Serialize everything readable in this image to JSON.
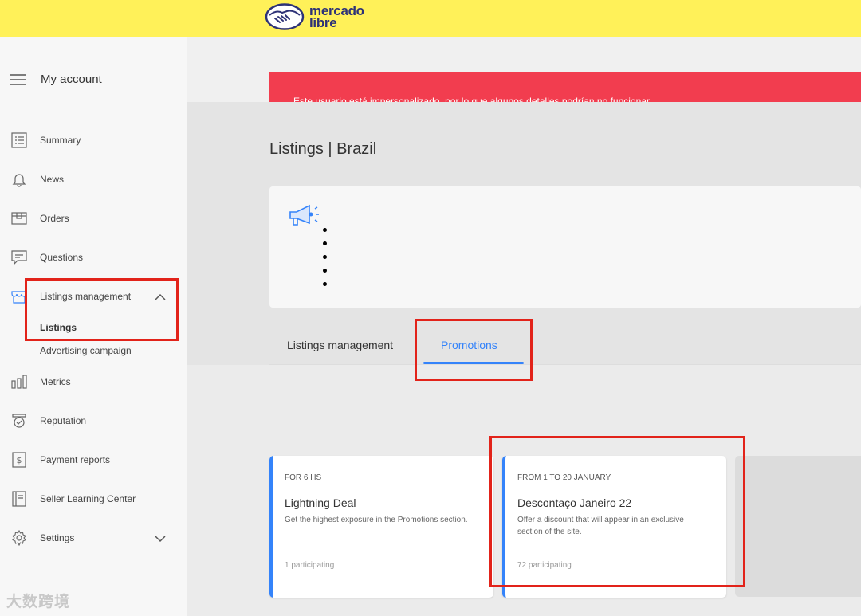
{
  "header": {
    "logo_line1": "mercado",
    "logo_line2": "libre",
    "logo_icon": "handshake-icon",
    "bg_color": "#fff159"
  },
  "sidebar": {
    "menu_label": "My account",
    "items": [
      {
        "label": "Summary",
        "icon": "summary-list-icon"
      },
      {
        "label": "News",
        "icon": "bell-icon"
      },
      {
        "label": "Orders",
        "icon": "box-icon"
      },
      {
        "label": "Questions",
        "icon": "chat-icon"
      },
      {
        "label": "Listings management",
        "icon": "store-icon",
        "expanded": true
      },
      {
        "label": "Metrics",
        "icon": "bar-chart-icon"
      },
      {
        "label": "Reputation",
        "icon": "badge-icon"
      },
      {
        "label": "Payment reports",
        "icon": "dollar-receipt-icon"
      },
      {
        "label": "Seller Learning Center",
        "icon": "book-icon"
      },
      {
        "label": "Settings",
        "icon": "gear-icon",
        "expanded": false
      }
    ],
    "sub_items": [
      {
        "label": "Listings",
        "active": true
      },
      {
        "label": "Advertising campaign",
        "active": false
      }
    ]
  },
  "alert": {
    "text": "Este usuario está impersonalizado, por lo que algunos detalles podrían no funcionar.",
    "color": "#f23d4f"
  },
  "page": {
    "title": "Listings | Brazil"
  },
  "notice": {
    "icon": "megaphone-icon"
  },
  "tabs": [
    {
      "label": "Listings management",
      "active": false
    },
    {
      "label": "Promotions",
      "active": true
    }
  ],
  "promotions": [
    {
      "tag": "FOR 6 HS",
      "title": "Lightning Deal",
      "description": "Get the highest exposure in the Promotions section.",
      "participating": "1 participating"
    },
    {
      "tag": "FROM 1 TO 20 JANUARY",
      "title": "Descontaço Janeiro 22",
      "description": "Offer a discount that will appear in an exclusive section of the site.",
      "participating": "72 participating"
    }
  ],
  "watermark": "大数跨境",
  "accent_color": "#3483fa",
  "highlight_color": "#e2231a"
}
